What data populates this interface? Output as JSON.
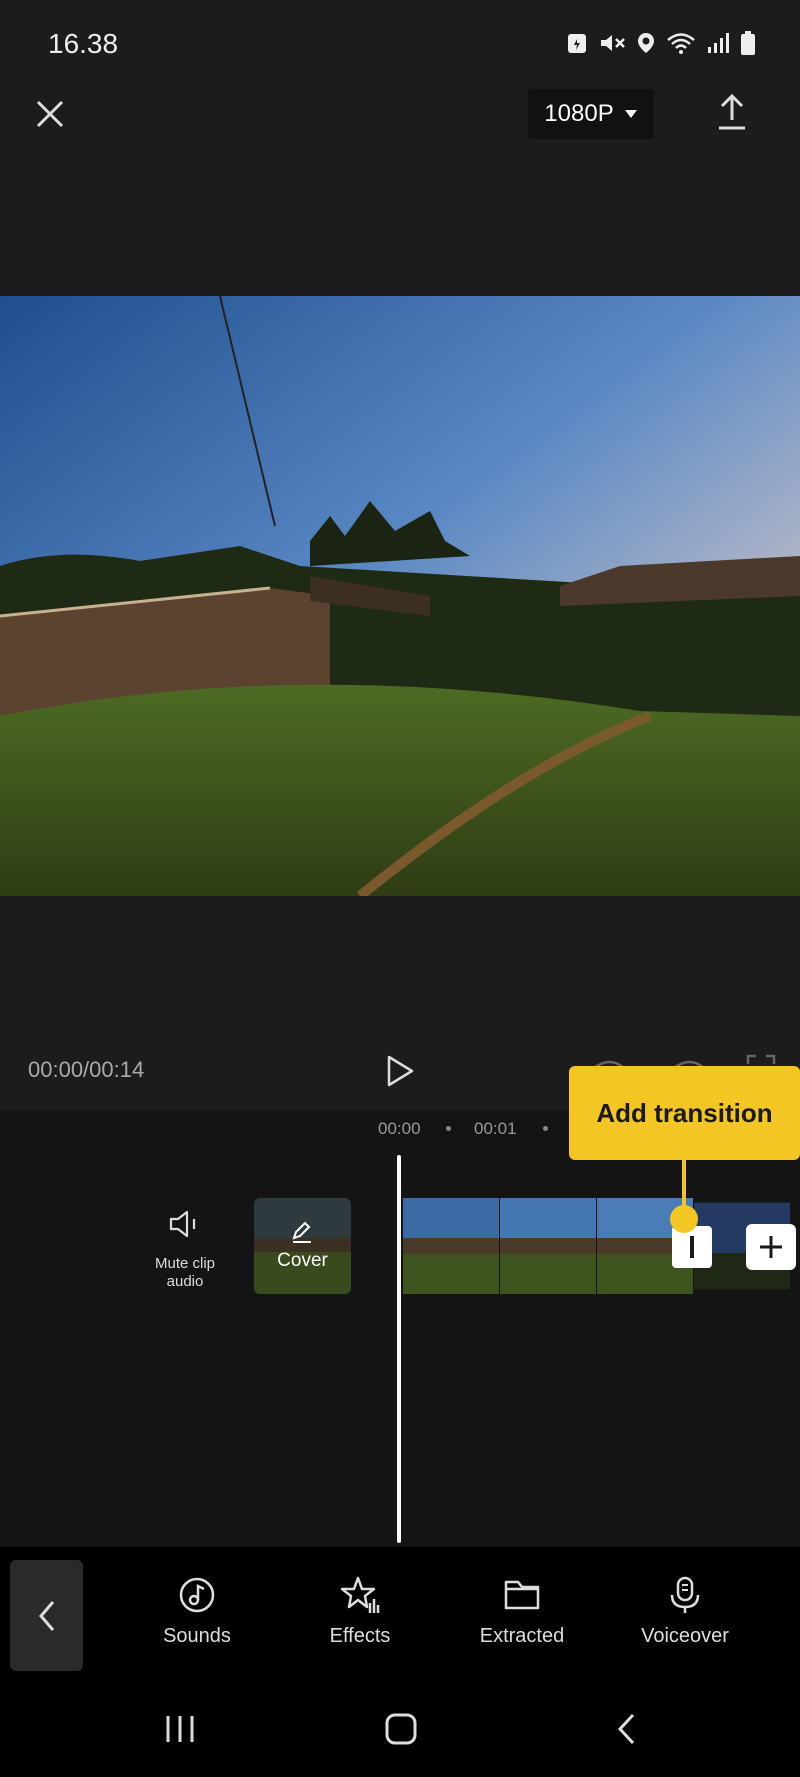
{
  "status_bar": {
    "time": "16.38"
  },
  "top_bar": {
    "resolution": "1080P"
  },
  "playback": {
    "timecode": "00:00/00:14"
  },
  "timeline": {
    "ruler": [
      "00:00",
      "00:01"
    ],
    "mute_label": "Mute clip audio",
    "cover_label": "Cover",
    "tooltip": "Add transition"
  },
  "toolbar": {
    "items": [
      {
        "label": "Sounds",
        "icon": "music-note-icon"
      },
      {
        "label": "Effects",
        "icon": "star-effects-icon"
      },
      {
        "label": "Extracted",
        "icon": "folder-icon"
      },
      {
        "label": "Voiceover",
        "icon": "microphone-icon"
      }
    ]
  },
  "colors": {
    "accent": "#f3c623",
    "background": "#1c1c1c",
    "timeline": "#141414"
  }
}
